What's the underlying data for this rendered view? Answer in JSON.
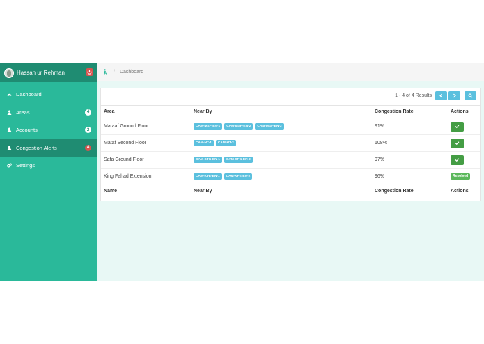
{
  "user": {
    "name": "Hassan ur Rehman"
  },
  "sidebar": {
    "items": [
      {
        "label": "Dashboard",
        "icon": "dashboard-icon",
        "badge": ""
      },
      {
        "label": "Areas",
        "icon": "user-icon",
        "badge": "4"
      },
      {
        "label": "Accounts",
        "icon": "user-icon",
        "badge": "2"
      },
      {
        "label": "Congestion Alerts",
        "icon": "user-icon",
        "badge": "4"
      },
      {
        "label": "Settings",
        "icon": "gears-icon",
        "badge": ""
      }
    ]
  },
  "breadcrumb": {
    "current": "Dashboard"
  },
  "pager": {
    "results": "1 - 4 of 4 Results"
  },
  "table": {
    "headers": [
      "Area",
      "Near By",
      "Congestion Rate",
      "Actions"
    ],
    "footer": [
      "Name",
      "Near By",
      "Congestion Rate",
      "Actions"
    ],
    "rows": [
      {
        "area": "Mataaf Ground Floor",
        "cams": [
          "CAM-MSF-EN-1",
          "CAM-MSF-EN-2",
          "CAM-MSF-EN-3"
        ],
        "rate": "91%",
        "resolved": ""
      },
      {
        "area": "Mataf Second Floor",
        "cams": [
          "CAM-HT-1",
          "CAM-HT-2"
        ],
        "rate": "108%",
        "resolved": ""
      },
      {
        "area": "Safa Ground Floor",
        "cams": [
          "CAM-SFG-EN-1",
          "CAM-SFG-EN-2"
        ],
        "rate": "97%",
        "resolved": ""
      },
      {
        "area": "King Fahad Extension",
        "cams": [
          "CAM-KFE-EN-1",
          "CAM-KFE-EN-2"
        ],
        "rate": "96%",
        "resolved": "Resolved"
      }
    ]
  },
  "colors": {
    "sidebar": "#2ab99a",
    "sidebar_active": "#1f8c72",
    "info": "#5bc0de",
    "success": "#449d44",
    "danger": "#d9534f"
  }
}
